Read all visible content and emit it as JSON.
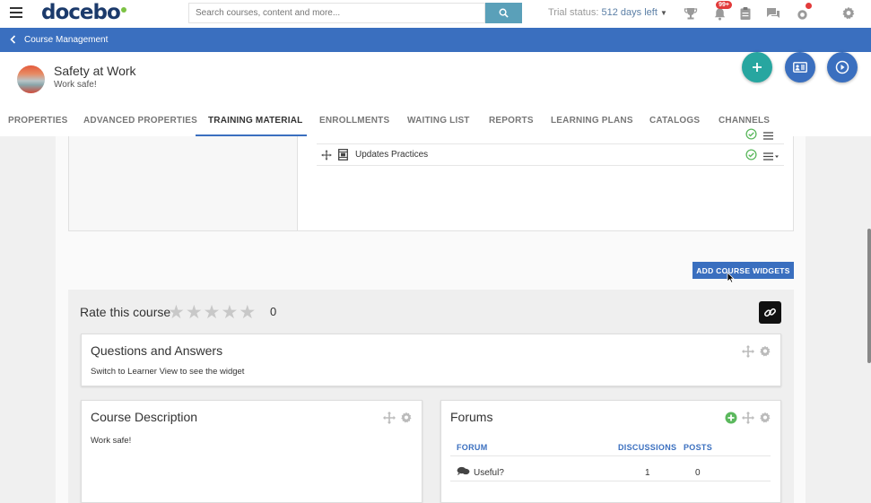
{
  "topbar": {
    "logo_text": "docebo",
    "search_placeholder": "Search courses, content and more...",
    "trial_label": "Trial status:",
    "trial_days": "512 days left",
    "notifications_badge": "99+"
  },
  "breadcrumb": {
    "label": "Course Management"
  },
  "course": {
    "title": "Safety at Work",
    "subtitle": "Work safe!"
  },
  "tabs": [
    {
      "label": "PROPERTIES"
    },
    {
      "label": "ADVANCED PROPERTIES"
    },
    {
      "label": "TRAINING MATERIAL"
    },
    {
      "label": "ENROLLMENTS"
    },
    {
      "label": "WAITING LIST"
    },
    {
      "label": "REPORTS"
    },
    {
      "label": "LEARNING PLANS"
    },
    {
      "label": "CATALOGS"
    },
    {
      "label": "CHANNELS"
    }
  ],
  "active_tab": "TRAINING MATERIAL",
  "training_material": {
    "items": [
      {
        "name": "Updates Practices",
        "status": "completed"
      }
    ]
  },
  "add_widgets_label": "ADD COURSE WIDGETS",
  "rating": {
    "label": "Rate this course",
    "count": "0",
    "max_stars": 5
  },
  "qa_widget": {
    "title": "Questions and Answers",
    "text": "Switch to Learner View to see the widget"
  },
  "description_widget": {
    "title": "Course Description",
    "text": "Work safe!"
  },
  "forums_widget": {
    "title": "Forums",
    "headers": {
      "forum": "FORUM",
      "discussions": "DISCUSSIONS",
      "posts": "POSTS"
    },
    "rows": [
      {
        "forum": "Useful?",
        "discussions": "1",
        "posts": "0"
      }
    ]
  },
  "colors": {
    "primary_blue": "#3a6fbf",
    "teal": "#27a6a0",
    "green_check": "#5bb85d",
    "search_button": "#5aa0b9"
  }
}
